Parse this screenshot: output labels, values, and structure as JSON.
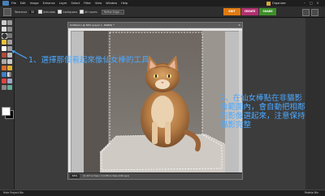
{
  "menubar": {
    "items": [
      "File",
      "Edit",
      "Image",
      "Enhance",
      "Layer",
      "Select",
      "Filter",
      "View",
      "Window",
      "Help"
    ],
    "organizer_label": "Organizer"
  },
  "options": {
    "tolerance_label": "Tolerance",
    "tolerance_value": "32",
    "antialias_label": "Anti-alias",
    "contiguous_label": "Contiguous",
    "all_layers_label": "All Layers",
    "refine_edge_label": "Refine Edge..."
  },
  "modes": {
    "edit": "EDIT",
    "create": "CREATE",
    "share": "SHARE"
  },
  "document": {
    "title": "Untitled-1 @ 66% (Layer 1, RGB/8) *",
    "zoom": "66%",
    "info": "11.67 inches x 14.58 inches (240 ppi)"
  },
  "annotations": {
    "note1": "1、選擇那個看起來像仙女棒的工具",
    "note2": "2、在仙女棒點在非貓影像範圍內，會自動把相鄰的影像選起來，注意保持貓影完整"
  },
  "bottombar": {
    "project_bin": "Hide Project Bin",
    "palette_bin": "Palette Bin"
  },
  "colors": {
    "accent_edit": "#e07a12",
    "accent_create": "#b0306f",
    "accent_share": "#3e8e2a",
    "annotation_blue": "#4aa8ff"
  }
}
